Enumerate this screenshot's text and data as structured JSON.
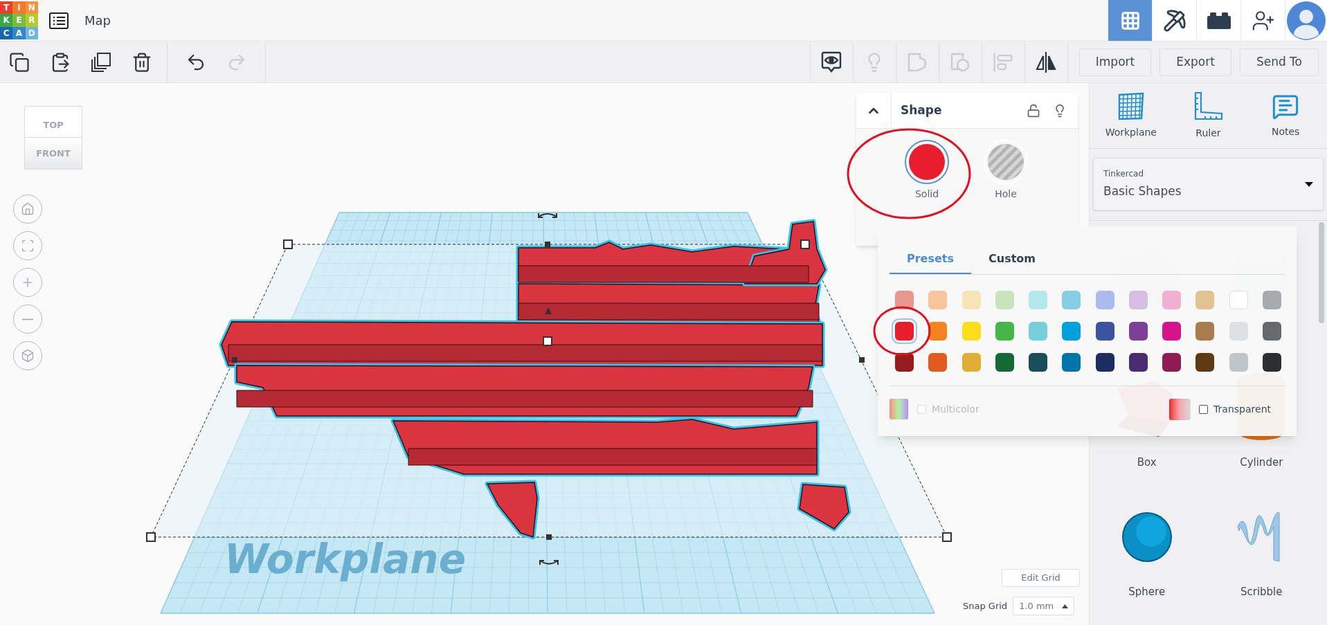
{
  "app": {
    "logo": [
      {
        "letter": "T",
        "color": "#e8402b"
      },
      {
        "letter": "I",
        "color": "#f37a2c"
      },
      {
        "letter": "N",
        "color": "#f5923e"
      },
      {
        "letter": "K",
        "color": "#3aa648"
      },
      {
        "letter": "E",
        "color": "#7cbb3e"
      },
      {
        "letter": "R",
        "color": "#b4cc2b"
      },
      {
        "letter": "C",
        "color": "#1766b0"
      },
      {
        "letter": "A",
        "color": "#3386cc"
      },
      {
        "letter": "D",
        "color": "#6db6e2"
      }
    ],
    "title": "Map"
  },
  "view_modes": [
    {
      "kind": "grid",
      "selected": true
    },
    {
      "kind": "pickaxe",
      "selected": false
    },
    {
      "kind": "bricks",
      "selected": false
    }
  ],
  "toolbar": {
    "edit_tools": [
      {
        "kind": "copy",
        "disabled": false
      },
      {
        "kind": "paste",
        "disabled": false
      },
      {
        "kind": "duplicate",
        "disabled": false
      },
      {
        "kind": "delete",
        "disabled": false
      }
    ],
    "history_tools": [
      {
        "kind": "undo",
        "disabled": false
      },
      {
        "kind": "redo",
        "disabled": true
      }
    ],
    "shape_tools": [
      {
        "kind": "notes",
        "disabled": false
      },
      {
        "kind": "lightbulb",
        "disabled": true
      },
      {
        "kind": "group",
        "disabled": true
      },
      {
        "kind": "ungroup",
        "disabled": true
      },
      {
        "kind": "align",
        "disabled": true
      },
      {
        "kind": "mirror",
        "disabled": false
      }
    ],
    "buttons": [
      "Import",
      "Export",
      "Send To"
    ]
  },
  "view_cube": {
    "top": "TOP",
    "front": "FRONT"
  },
  "nav_controls": [
    {
      "kind": "home"
    },
    {
      "kind": "fit"
    },
    {
      "kind": "zoom_in"
    },
    {
      "kind": "zoom_out"
    },
    {
      "kind": "perspective"
    }
  ],
  "workplane": {
    "label": "Workplane"
  },
  "shape_panel": {
    "title": "Shape",
    "locked": false,
    "types": [
      {
        "label": "Solid",
        "kind": "solid",
        "selected": true
      },
      {
        "label": "Hole",
        "kind": "hole",
        "selected": false
      }
    ]
  },
  "color_picker": {
    "tabs": [
      {
        "label": "Presets",
        "selected": true
      },
      {
        "label": "Custom",
        "selected": false
      }
    ],
    "swatches": [
      {
        "color": "#e9968b",
        "selected": false
      },
      {
        "color": "#f8c49c",
        "selected": false
      },
      {
        "color": "#f8e3b5",
        "selected": false
      },
      {
        "color": "#c9e3bc",
        "selected": false
      },
      {
        "color": "#b2e8ee",
        "selected": false
      },
      {
        "color": "#88cde6",
        "selected": false
      },
      {
        "color": "#abbbee",
        "selected": false
      },
      {
        "color": "#d7bde4",
        "selected": false
      },
      {
        "color": "#efb0d3",
        "selected": false
      },
      {
        "color": "#e2c193",
        "selected": false
      },
      {
        "color": "#ffffff",
        "selected": false
      },
      {
        "color": "#a8abad",
        "selected": false
      },
      {
        "color": "#e81d2d",
        "selected": true
      },
      {
        "color": "#f58220",
        "selected": false
      },
      {
        "color": "#fede1a",
        "selected": false
      },
      {
        "color": "#46b649",
        "selected": false
      },
      {
        "color": "#76cfdb",
        "selected": false
      },
      {
        "color": "#00a0dc",
        "selected": false
      },
      {
        "color": "#3a54a0",
        "selected": false
      },
      {
        "color": "#7d3f97",
        "selected": false
      },
      {
        "color": "#d4128a",
        "selected": false
      },
      {
        "color": "#a97b4f",
        "selected": false
      },
      {
        "color": "#dee1e3",
        "selected": false
      },
      {
        "color": "#666a6d",
        "selected": false
      },
      {
        "color": "#961c1f",
        "selected": false
      },
      {
        "color": "#e1591f",
        "selected": false
      },
      {
        "color": "#e0ac34",
        "selected": false
      },
      {
        "color": "#146a37",
        "selected": false
      },
      {
        "color": "#1b4c59",
        "selected": false
      },
      {
        "color": "#0073a8",
        "selected": false
      },
      {
        "color": "#1c2d64",
        "selected": false
      },
      {
        "color": "#4a2b72",
        "selected": false
      },
      {
        "color": "#901a54",
        "selected": false
      },
      {
        "color": "#603a13",
        "selected": false
      },
      {
        "color": "#bfc5cb",
        "selected": false
      },
      {
        "color": "#2b2f31",
        "selected": false
      }
    ],
    "multicolor": {
      "label": "Multicolor",
      "checked": false,
      "disabled": true
    },
    "transparent": {
      "label": "Transparent",
      "checked": false
    }
  },
  "grid_controls": {
    "edit_button": "Edit Grid",
    "snap_label": "Snap Grid",
    "snap_value": "1.0 mm"
  },
  "right_panel": {
    "tools": [
      {
        "kind": "workplane",
        "label": "Workplane"
      },
      {
        "kind": "ruler",
        "label": "Ruler"
      },
      {
        "kind": "notes",
        "label": "Notes"
      }
    ],
    "library": {
      "provider": "Tinkercad",
      "name": "Basic Shapes"
    },
    "shapes": [
      {
        "kind": "box_hole"
      },
      {
        "kind": "cylinder_hole"
      },
      {
        "kind": "box",
        "label": "Box"
      },
      {
        "kind": "cylinder",
        "label": "Cylinder"
      },
      {
        "kind": "sphere",
        "label": "Sphere"
      },
      {
        "kind": "scribble",
        "label": "Scribble"
      }
    ]
  }
}
